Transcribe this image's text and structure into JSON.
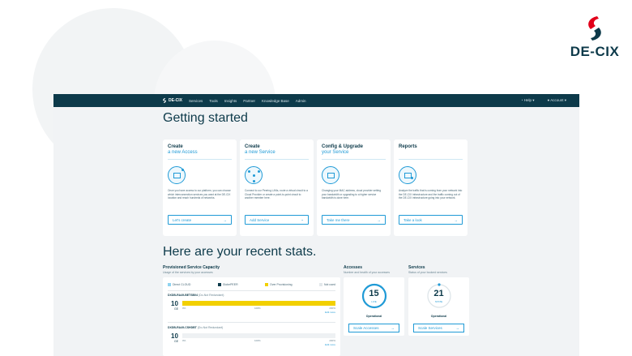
{
  "brand": {
    "name": "DE-CIX"
  },
  "nav": {
    "logo_text": "DE-CIX",
    "items": [
      "Services",
      "Tools",
      "Insights",
      "Partner",
      "Knowledge Base",
      "Admin"
    ],
    "help": "Help",
    "account": "Account"
  },
  "getting_started": {
    "title": "Getting started",
    "cards": [
      {
        "title": "Create",
        "subtitle": "a new Access",
        "text": "Once you have access to our platform, you can choose which interconnection services you want at the DE-CIX location and reach hundreds of networks.",
        "button": "Let's create",
        "btn_icon": "→"
      },
      {
        "title": "Create",
        "subtitle": "a new Service",
        "text": "Connect to our Peering LANs, route a virtual circuit to a Cloud Provider or create a point-to-point circuit to another member here.",
        "button": "Add Service",
        "btn_icon": "⌄"
      },
      {
        "title": "Config & Upgrade",
        "subtitle": "your Service",
        "text": "Changing your MAC address, cloud provider setting your bandwidth or upgrading to a higher service bandwidth is done here.",
        "button": "Take me there",
        "btn_icon": "→"
      },
      {
        "title": "Reports",
        "subtitle": "",
        "text": "Analyze the traffic that is coming from your network into the DE-CIX infrastructure and the traffic coming out of the DE-CIX infrastructure going into your network.",
        "button": "Take a look",
        "btn_icon": "→"
      }
    ]
  },
  "stats": {
    "title": "Here are your recent stats.",
    "capacity": {
      "title": "Provisioned Service Capacity",
      "subtitle": "Usage of the services by your accesses",
      "legend": [
        "Direct CLOUD",
        "GlobePEER",
        "Over Provisioning",
        "Not used"
      ],
      "legend_colors": [
        "#8fd3f0",
        "#0d3a4a",
        "#f2d000",
        "#e3e8eb"
      ],
      "rows": [
        {
          "name": "DXDB-RA49-BETSB04",
          "note": "(Do-Not Redundant)",
          "value": "10",
          "unit": "GE",
          "fill": 1.0,
          "ticks": [
            "0%",
            "100%",
            "200%"
          ],
          "link": "Edit more"
        },
        {
          "name": "DXDB-RA49-CSHDBT",
          "note": "(Do-Not Redundant)",
          "value": "10",
          "unit": "GE",
          "fill": 0.0,
          "ticks": [
            "0%",
            "100%",
            "200%"
          ],
          "link": "Edit more"
        }
      ]
    },
    "accesses": {
      "title": "Accesses",
      "subtitle": "Number and health of your accesses",
      "count": "15",
      "label": "LIVE",
      "status": "Operational",
      "button": "Scale Accesses"
    },
    "services": {
      "title": "Services",
      "subtitle": "Status of your booked services",
      "count": "21",
      "label": "STATE",
      "status": "Operational",
      "button": "Scale Services"
    }
  }
}
